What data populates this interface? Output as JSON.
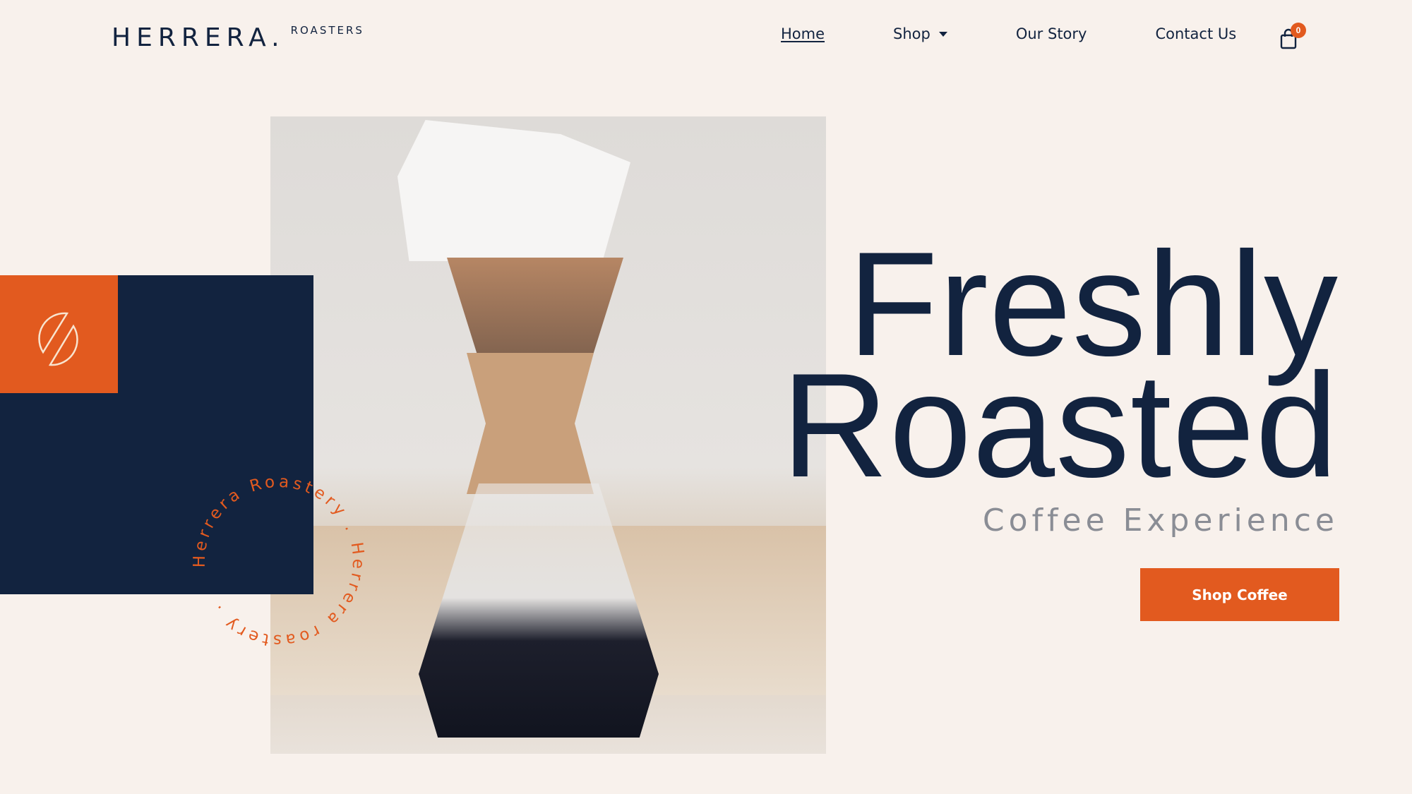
{
  "brand": {
    "name": "HERRERA.",
    "sub": "ROASTERS"
  },
  "nav": {
    "items": [
      {
        "label": "Home",
        "active": true
      },
      {
        "label": "Shop",
        "has_dropdown": true
      },
      {
        "label": "Our Story"
      },
      {
        "label": "Contact Us"
      }
    ],
    "cart": {
      "icon": "shopping-bag-icon",
      "count": "0"
    }
  },
  "hero": {
    "title_line1": "Freshly",
    "title_line2": "Roasted",
    "subtitle": "Coffee Experience",
    "cta_label": "Shop Coffee",
    "image_alt": "Chemex pour-over coffee maker with filter and brewed coffee",
    "badge_text": "Herrera Roastery . Herrera roastery . ",
    "emblem_icon": "split-coffee-bean-icon"
  },
  "colors": {
    "background": "#f8f1ec",
    "navy": "#12233f",
    "accent": "#e25a1f",
    "subtitle_gray": "#8a8d95"
  }
}
